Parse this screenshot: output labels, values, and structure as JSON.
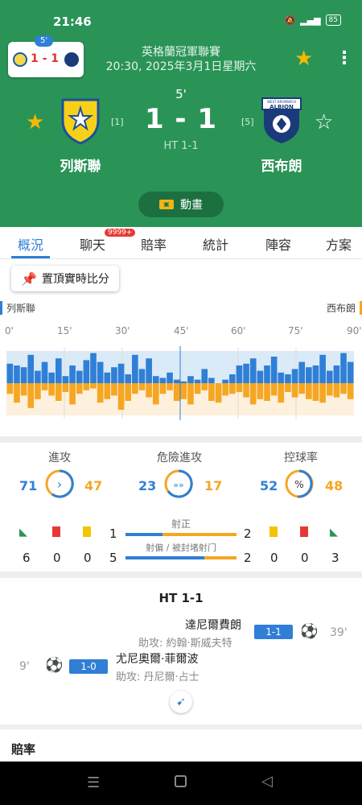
{
  "status_bar": {
    "time": "21:46",
    "battery": "85"
  },
  "mini_card": {
    "minute": "5'",
    "score": "1 - 1"
  },
  "header": {
    "league": "英格蘭冠軍聯賽",
    "kickoff": "20:30, 2025年3月1日星期六",
    "minute": "5'",
    "score": "1 - 1",
    "half_time": "HT 1-1",
    "home": {
      "name": "列斯聯",
      "rank": "[1]"
    },
    "away": {
      "name": "西布朗",
      "rank": "[5]"
    },
    "animation_label": "動畫",
    "away_logo_text": "ALBION",
    "away_logo_small": "WEST BROMWICH"
  },
  "tabs": {
    "items": [
      "概況",
      "聊天",
      "賠率",
      "統計",
      "陣容",
      "方案"
    ],
    "chat_badge": "9999+"
  },
  "momentum": {
    "pin_label": "置頂實時比分",
    "home_label": "列斯聯",
    "away_label": "西布朗",
    "ticks": [
      "0'",
      "15'",
      "30'",
      "45'",
      "60'",
      "75'",
      "90'"
    ],
    "home_bars": [
      0.55,
      0.5,
      0.45,
      0.8,
      0.35,
      0.6,
      0.3,
      0.7,
      0.2,
      0.5,
      0.35,
      0.65,
      0.85,
      0.6,
      0.3,
      0.45,
      0.55,
      0.25,
      0.8,
      0.4,
      0.7,
      0.2,
      0.15,
      0.3,
      0.1,
      0.05,
      0.2,
      0.1,
      0.4,
      0.15,
      0.0,
      0.1,
      0.25,
      0.5,
      0.55,
      0.7,
      0.35,
      0.5,
      0.75,
      0.3,
      0.25,
      0.4,
      0.6,
      0.45,
      0.5,
      0.8,
      0.35,
      0.5,
      0.85,
      0.6
    ],
    "away_bars": [
      0.3,
      0.55,
      0.35,
      0.7,
      0.45,
      0.2,
      0.35,
      0.5,
      0.25,
      0.6,
      0.3,
      0.2,
      0.15,
      0.55,
      0.45,
      0.35,
      0.75,
      0.5,
      0.3,
      0.2,
      0.4,
      0.6,
      0.3,
      0.2,
      0.5,
      0.45,
      0.6,
      0.3,
      0.2,
      0.5,
      0.55,
      0.35,
      0.3,
      0.25,
      0.4,
      0.6,
      0.45,
      0.5,
      0.35,
      0.55,
      0.25,
      0.4,
      0.3,
      0.45,
      0.5,
      0.55,
      0.35,
      0.4,
      0.3,
      0.45
    ],
    "current_minute": 45
  },
  "stats": {
    "attack": {
      "label": "進攻",
      "home": "71",
      "away": "47",
      "icon": "chevron-right"
    },
    "danger": {
      "label": "危險進攻",
      "home": "23",
      "away": "17",
      "icon": "triple-chevron"
    },
    "possession": {
      "label": "控球率",
      "home": "52",
      "away": "48",
      "icon": "percent"
    },
    "shots_on": {
      "label": "射正",
      "home": "1",
      "away": "2",
      "home_share": 0.33
    },
    "shots_off": {
      "label": "射偏 / 被封堵射门",
      "home": "5",
      "away": "2",
      "home_share": 0.71
    },
    "home_corners": "6",
    "home_red": "0",
    "home_yellow": "0",
    "away_yellow": "0",
    "away_red": "0",
    "away_corners": "3"
  },
  "events": {
    "title": "HT 1-1",
    "away_goal": {
      "player": "達尼爾費朗",
      "assist": "助攻: 約翰·斯威夫特",
      "score": "1-1",
      "minute": "39'"
    },
    "home_goal": {
      "player": "尤尼奧爾·菲爾波",
      "assist": "助攻: 丹尼爾·占士",
      "score": "1-0",
      "minute": "9'"
    }
  },
  "odds": {
    "title": "賠率"
  },
  "colors": {
    "header_green": "#2a9457",
    "home_blue": "#2f7fd6",
    "away_orange": "#f5a623",
    "star_gold": "#f5b800"
  }
}
